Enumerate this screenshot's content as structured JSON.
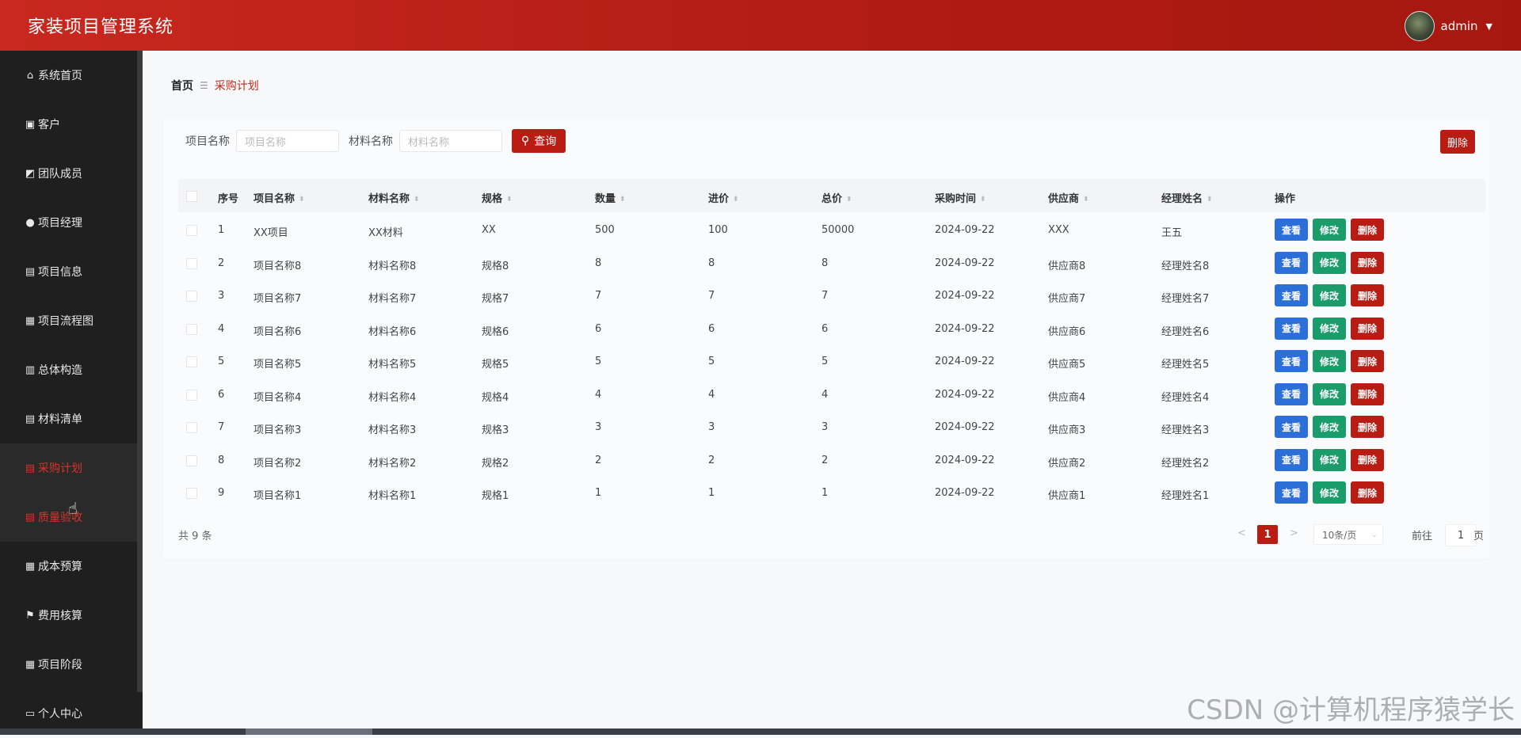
{
  "header": {
    "app_title": "家装项目管理系统",
    "username": "admin",
    "caret": "▼"
  },
  "sidebar": {
    "items": [
      {
        "label": "系统首页",
        "icon": "⌂"
      },
      {
        "label": "客户",
        "icon": "▣"
      },
      {
        "label": "团队成员",
        "icon": "◩"
      },
      {
        "label": "项目经理",
        "icon": "●"
      },
      {
        "label": "项目信息",
        "icon": "▤"
      },
      {
        "label": "项目流程图",
        "icon": "▦"
      },
      {
        "label": "总体构造",
        "icon": "▥"
      },
      {
        "label": "材料清单",
        "icon": "▤"
      },
      {
        "label": "采购计划",
        "icon": "▤"
      },
      {
        "label": "质量验收",
        "icon": "▤"
      },
      {
        "label": "成本预算",
        "icon": "▦"
      },
      {
        "label": "费用核算",
        "icon": "⚑"
      },
      {
        "label": "项目阶段",
        "icon": "▦"
      },
      {
        "label": "个人中心",
        "icon": "▭"
      }
    ],
    "active_index": 8
  },
  "breadcrumb": {
    "home": "首页",
    "separator": "☰",
    "current": "采购计划"
  },
  "search": {
    "project_label": "项目名称",
    "project_placeholder": "项目名称",
    "material_label": "材料名称",
    "material_placeholder": "材料名称",
    "search_button": "查询",
    "search_icon": "⚲",
    "bulk_delete": "删除"
  },
  "table": {
    "columns": [
      "序号",
      "项目名称",
      "材料名称",
      "规格",
      "数量",
      "进价",
      "总价",
      "采购时间",
      "供应商",
      "经理姓名",
      "操作"
    ],
    "sort_icon": "⬍",
    "rows": [
      [
        "1",
        "XX项目",
        "XX材料",
        "XX",
        "500",
        "100",
        "50000",
        "2024-09-22",
        "XXX",
        "王五"
      ],
      [
        "2",
        "项目名称8",
        "材料名称8",
        "规格8",
        "8",
        "8",
        "8",
        "2024-09-22",
        "供应商8",
        "经理姓名8"
      ],
      [
        "3",
        "项目名称7",
        "材料名称7",
        "规格7",
        "7",
        "7",
        "7",
        "2024-09-22",
        "供应商7",
        "经理姓名7"
      ],
      [
        "4",
        "项目名称6",
        "材料名称6",
        "规格6",
        "6",
        "6",
        "6",
        "2024-09-22",
        "供应商6",
        "经理姓名6"
      ],
      [
        "5",
        "项目名称5",
        "材料名称5",
        "规格5",
        "5",
        "5",
        "5",
        "2024-09-22",
        "供应商5",
        "经理姓名5"
      ],
      [
        "6",
        "项目名称4",
        "材料名称4",
        "规格4",
        "4",
        "4",
        "4",
        "2024-09-22",
        "供应商4",
        "经理姓名4"
      ],
      [
        "7",
        "项目名称3",
        "材料名称3",
        "规格3",
        "3",
        "3",
        "3",
        "2024-09-22",
        "供应商3",
        "经理姓名3"
      ],
      [
        "8",
        "项目名称2",
        "材料名称2",
        "规格2",
        "2",
        "2",
        "2",
        "2024-09-22",
        "供应商2",
        "经理姓名2"
      ],
      [
        "9",
        "项目名称1",
        "材料名称1",
        "规格1",
        "1",
        "1",
        "1",
        "2024-09-22",
        "供应商1",
        "经理姓名1"
      ]
    ],
    "actions": {
      "view": "查看",
      "edit": "修改",
      "delete": "删除"
    }
  },
  "pagination": {
    "total_text": "共 9 条",
    "prev": "<",
    "next": ">",
    "current_page": "1",
    "page_size": "10条/页",
    "page_size_chevron": "⌄",
    "goto_prefix": "前往",
    "goto_value": "1",
    "goto_suffix": "页"
  },
  "watermark": "CSDN @计算机程序猿学长",
  "colors": {
    "primary": "#b81c13",
    "view": "#2d6fd8",
    "edit": "#1a9c6b",
    "sidebar": "#1f1f1f"
  }
}
